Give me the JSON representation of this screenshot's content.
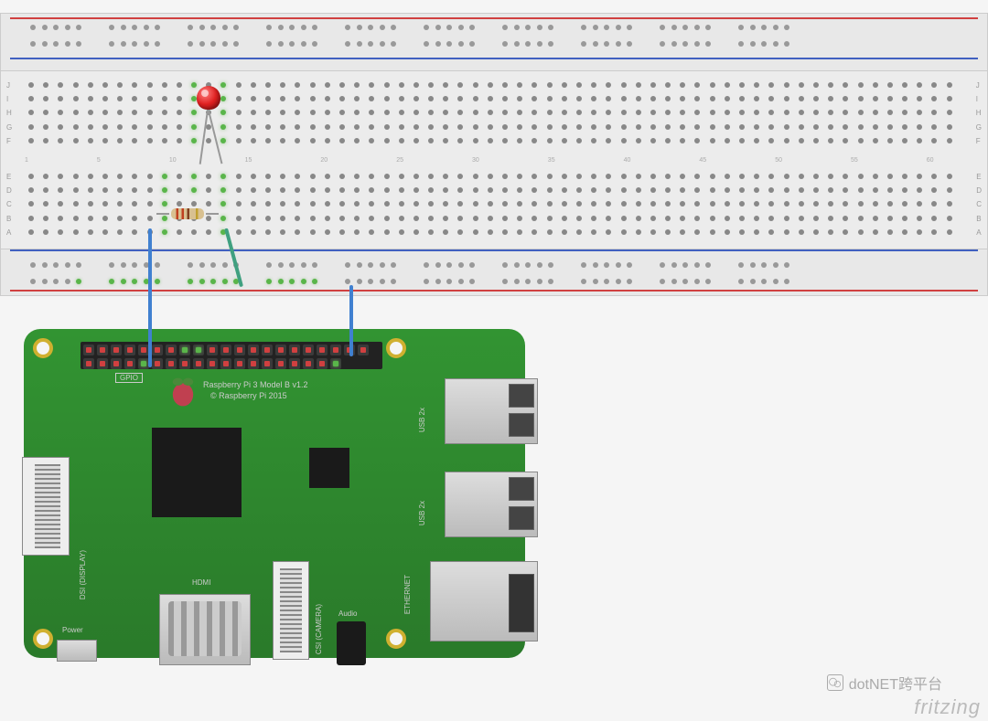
{
  "board": {
    "model": "Raspberry Pi 3 Model B v1.2",
    "copyright": "© Raspberry Pi 2015",
    "gpio_label": "GPIO",
    "ports": {
      "dsi": "DSI (DISPLAY)",
      "csi": "CSI (CAMERA)",
      "hdmi": "HDMI",
      "audio": "Audio",
      "power": "Power",
      "ethernet": "ETHERNET",
      "usb1": "USB 2x",
      "usb2": "USB 2x"
    }
  },
  "components": {
    "led": {
      "type": "LED",
      "color": "red",
      "anode_col": 14,
      "cathode_col": 12
    },
    "resistor": {
      "type": "resistor",
      "from_col": 10,
      "to_col": 14,
      "bands": [
        "red",
        "red",
        "brown",
        "gold"
      ]
    }
  },
  "wires": [
    {
      "color": "blue",
      "from": "breadboard col 10 bottom",
      "to": "pi GPIO pin 6 (GND)"
    },
    {
      "color": "green",
      "from": "breadboard col 14 bottom",
      "to": "breadboard bottom rail"
    },
    {
      "color": "blue",
      "from": "breadboard bottom rail col 22",
      "to": "pi GPIO pin last"
    }
  ],
  "breadboard": {
    "columns": 63,
    "row_labels_top": [
      "J",
      "I",
      "H",
      "G",
      "F"
    ],
    "row_labels_bottom": [
      "E",
      "D",
      "C",
      "B",
      "A"
    ]
  },
  "watermark": "dotNET跨平台",
  "software": "fritzing"
}
